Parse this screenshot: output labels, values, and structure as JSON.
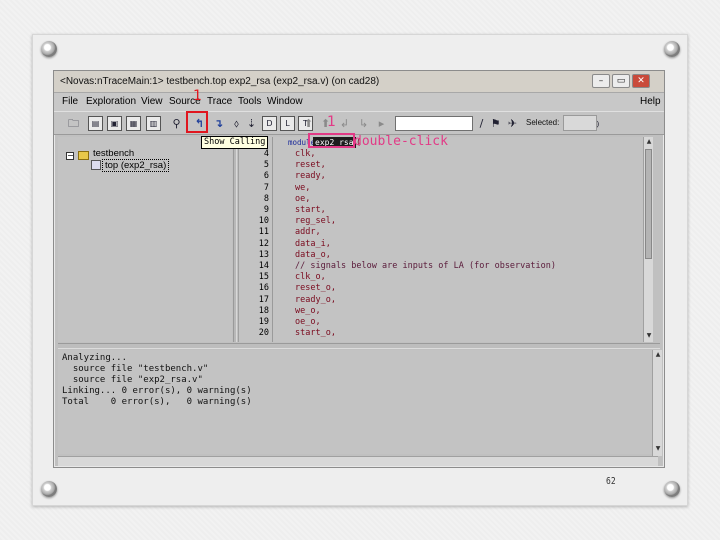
{
  "window": {
    "title": "<Novas:nTraceMain:1> testbench.top exp2_rsa (exp2_rsa.v) (on cad28)",
    "controls": [
      "–",
      "▭",
      "✕"
    ]
  },
  "menu": [
    {
      "label": "File"
    },
    {
      "label": "Exploration"
    },
    {
      "label": "View"
    },
    {
      "label": "Source"
    },
    {
      "label": "Trace"
    },
    {
      "label": "Tools"
    },
    {
      "label": "Window"
    },
    {
      "label": "Help"
    }
  ],
  "toolbar": {
    "tooltip": "Show Calling",
    "selected_label": "Selected:"
  },
  "hierarchy": {
    "root": "testbench",
    "child": "top (exp2_rsa)"
  },
  "source": {
    "keyword": "module",
    "selected_token": "exp2_rsa",
    "paren": "(",
    "lines": [
      {
        "n": "4",
        "text": "clk,"
      },
      {
        "n": "5",
        "text": "reset,"
      },
      {
        "n": "6",
        "text": "ready,"
      },
      {
        "n": "7",
        "text": "we,"
      },
      {
        "n": "8",
        "text": "oe,"
      },
      {
        "n": "9",
        "text": "start,"
      },
      {
        "n": "10",
        "text": "reg_sel,"
      },
      {
        "n": "11",
        "text": "addr,"
      },
      {
        "n": "12",
        "text": "data_i,"
      },
      {
        "n": "13",
        "text": "data_o,"
      },
      {
        "n": "14",
        "text": "// signals below are inputs of LA (for observation)"
      },
      {
        "n": "15",
        "text": "clk_o,"
      },
      {
        "n": "16",
        "text": "reset_o,"
      },
      {
        "n": "17",
        "text": "ready_o,"
      },
      {
        "n": "18",
        "text": "we_o,"
      },
      {
        "n": "19",
        "text": "oe_o,"
      },
      {
        "n": "20",
        "text": "start_o,"
      }
    ]
  },
  "messages": [
    "Analyzing...",
    "  source file \"testbench.v\"",
    "  source file \"exp2_rsa.v\"",
    "Linking... 0 error(s), 0 warning(s)",
    "Total    0 error(s),   0 warning(s)"
  ],
  "annotations": {
    "step1": "1",
    "step2": "1",
    "double_click": "double-click"
  },
  "page_number": "62",
  "colors": {
    "annotation_red": "#e0161f",
    "annotation_pink": "#e23a86",
    "code_text": "#7a0a1e",
    "pane_bg": "#c3c3c3"
  }
}
